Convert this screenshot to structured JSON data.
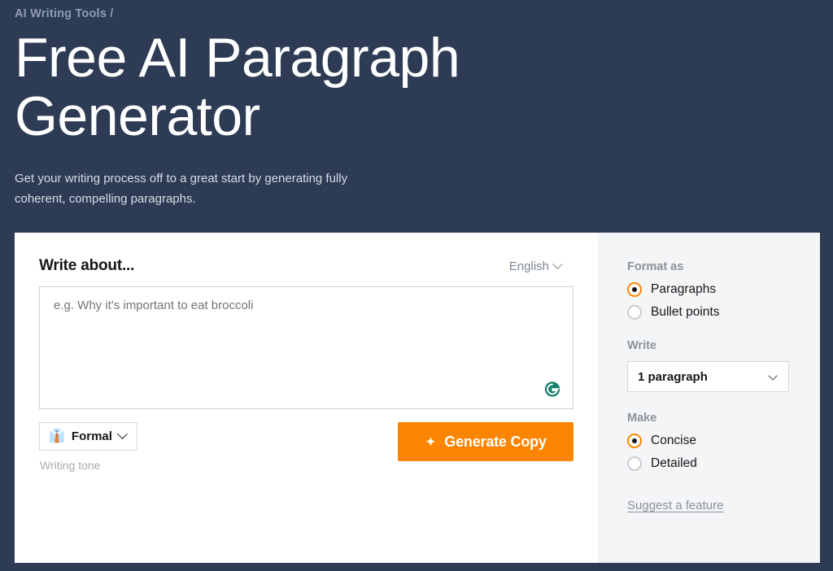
{
  "theme": {
    "hero_bg": "#2e3b55",
    "accent_orange": "#fb8500",
    "card_bg": "#ffffff",
    "sidebar_bg": "#f4f5f7",
    "grammarly_green": "#15806a"
  },
  "hero": {
    "breadcrumb": "AI Writing Tools /",
    "title": "Free AI Paragraph Generator",
    "subtitle": "Get your writing process off to a great start by generating fully coherent, compelling paragraphs."
  },
  "editor": {
    "heading": "Write about...",
    "language": {
      "value": "English",
      "chevron_icon": "chevron-down-icon"
    },
    "input": {
      "value": "",
      "placeholder": "e.g. Why it's important to eat broccoli"
    },
    "grammarly_icon": "grammarly-icon",
    "tone": {
      "emoji": "👔",
      "emoji_name": "necktie-icon",
      "value": "Formal",
      "caption": "Writing tone",
      "chevron_icon": "chevron-down-icon"
    },
    "generate": {
      "icon": "✦",
      "icon_name": "sparkles-icon",
      "label": "Generate Copy"
    }
  },
  "sidebar": {
    "format": {
      "label": "Format as",
      "options": [
        {
          "label": "Paragraphs",
          "selected": true
        },
        {
          "label": "Bullet points",
          "selected": false
        }
      ]
    },
    "write": {
      "label": "Write",
      "selected": "1 paragraph",
      "chevron_icon": "chevron-down-icon"
    },
    "make": {
      "label": "Make",
      "options": [
        {
          "label": "Concise",
          "selected": true
        },
        {
          "label": "Detailed",
          "selected": false
        }
      ]
    },
    "suggest_link": "Suggest a feature"
  }
}
